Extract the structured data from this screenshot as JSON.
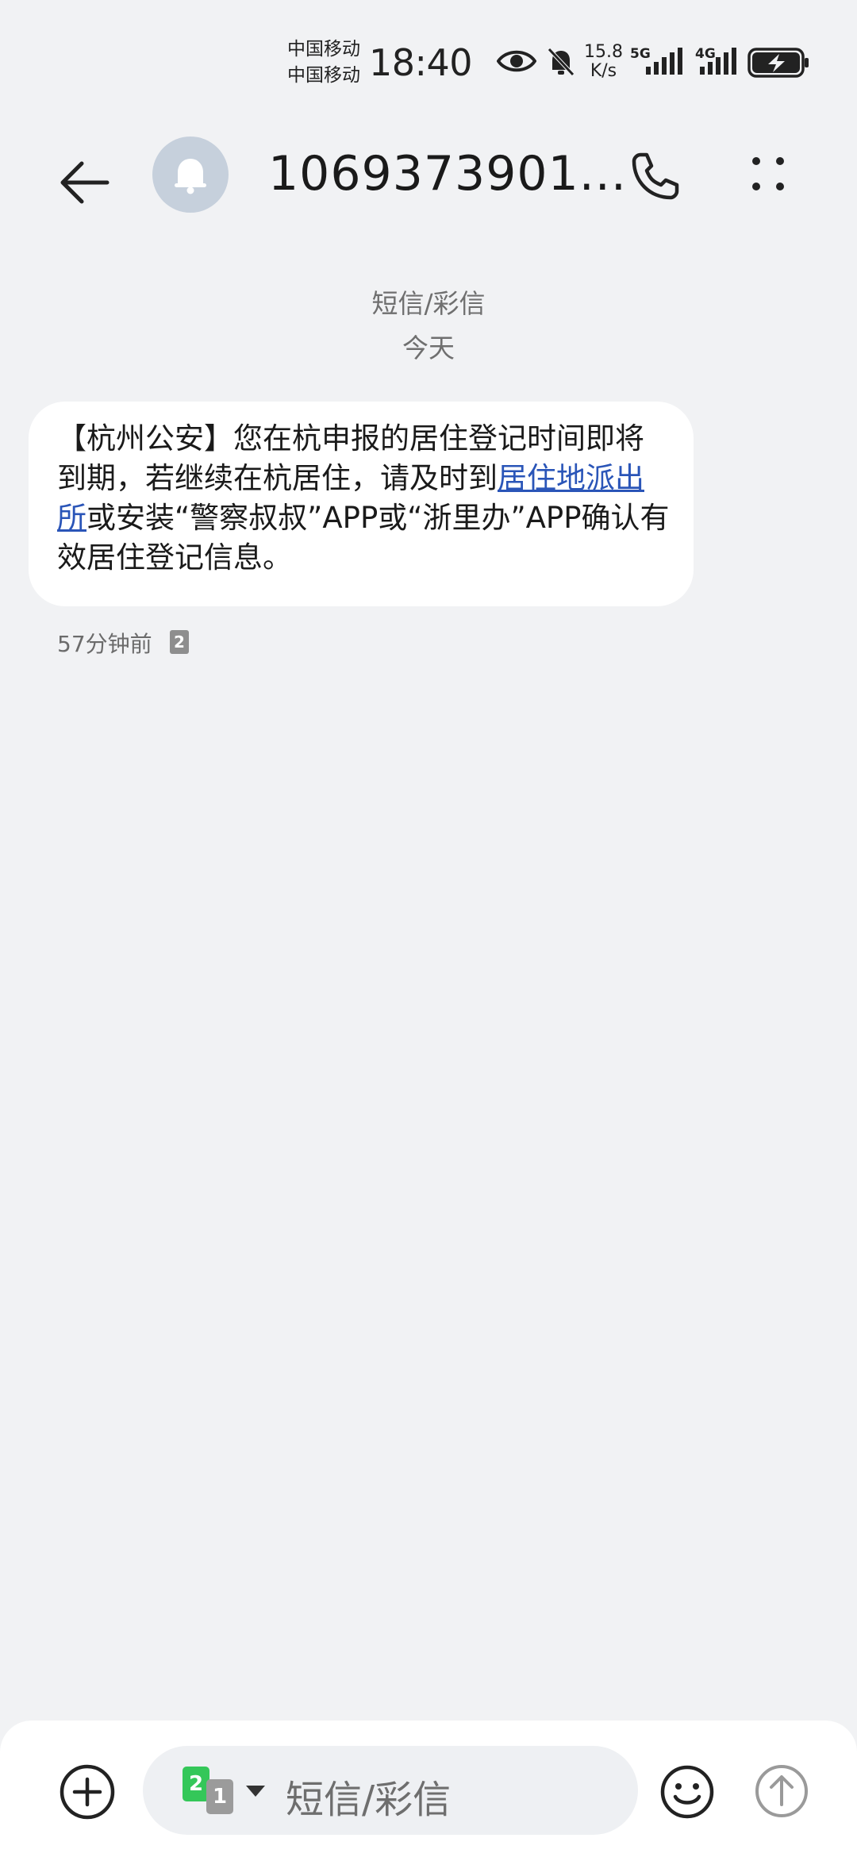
{
  "status_bar": {
    "carrier_1": "中国移动",
    "carrier_2": "中国移动",
    "time": "18:40",
    "speed_value": "15.8",
    "speed_unit": "K/s",
    "net_1": "5G",
    "net_2": "4G",
    "icons": [
      "eye-icon",
      "bell-off-icon",
      "signal-icon",
      "signal-icon",
      "battery-charging-icon"
    ]
  },
  "header": {
    "title": "1069373901...",
    "avatar_icon": "bell-icon",
    "back_icon": "arrow-left-icon",
    "call_icon": "phone-icon",
    "more_icon": "more-dots-icon"
  },
  "thread": {
    "type_label": "短信/彩信",
    "date_label": "今天"
  },
  "message": {
    "text_before_link": "【杭州公安】您在杭申报的居住登记时间即将到期，若继续在杭居住，请及时到",
    "link_text": "居住地派出所",
    "text_after_link": "或安装“警察叔叔”APP或“浙里办”APP确认有效居住登记信息。",
    "time": "57分钟前",
    "sim_badge": "2"
  },
  "composer": {
    "add_icon": "plus-circle-icon",
    "sim_primary": "2",
    "sim_secondary": "1",
    "placeholder": "短信/彩信",
    "emoji_icon": "smiley-icon",
    "send_icon": "send-arrow-icon"
  },
  "colors": {
    "background": "#f1f2f4",
    "bubble": "#ffffff",
    "link": "#2a55b8",
    "avatar": "#c6d0dc",
    "sim_green": "#34c759"
  }
}
